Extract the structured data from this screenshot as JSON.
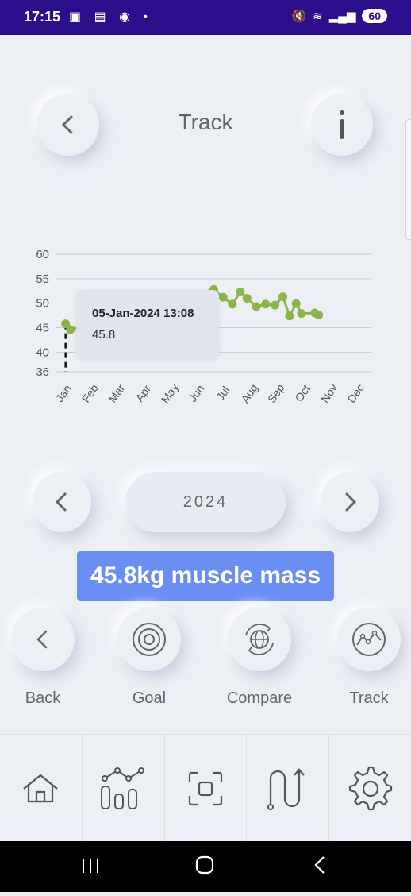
{
  "status_bar": {
    "time": "17:15",
    "battery": "60"
  },
  "header": {
    "title": "Track"
  },
  "chart_data": {
    "type": "line",
    "x_tick_labels": [
      "Jan",
      "Feb",
      "Mar",
      "Apr",
      "May",
      "Jun",
      "Jul",
      "Aug",
      "Sep",
      "Oct",
      "Nov",
      "Dec"
    ],
    "y_tick_labels": [
      "60",
      "55",
      "50",
      "45",
      "40",
      "36"
    ],
    "ylim": [
      36,
      60
    ],
    "grid": true,
    "line_color": "#8bb54a",
    "series": [
      {
        "points": [
          [
            0.02,
            45.8
          ],
          [
            0.2,
            44.6
          ],
          [
            5.6,
            52.8
          ],
          [
            5.95,
            51.2
          ],
          [
            6.3,
            49.8
          ],
          [
            6.6,
            52.3
          ],
          [
            6.85,
            51.0
          ],
          [
            7.2,
            49.3
          ],
          [
            7.55,
            49.8
          ],
          [
            7.9,
            49.6
          ],
          [
            8.2,
            51.3
          ],
          [
            8.45,
            47.4
          ],
          [
            8.7,
            49.9
          ],
          [
            8.9,
            47.9
          ],
          [
            9.4,
            48.0
          ],
          [
            9.55,
            47.6
          ]
        ]
      }
    ],
    "tooltip": {
      "title": "05-Jan-2024 13:08",
      "value": "45.8"
    }
  },
  "year_selector": {
    "year": "2024"
  },
  "measurement_badge": "45.8kg muscle mass",
  "actions": [
    {
      "label": "Back",
      "icon": "chevron-left-icon"
    },
    {
      "label": "Goal",
      "icon": "target-icon"
    },
    {
      "label": "Compare",
      "icon": "globe-sync-icon"
    },
    {
      "label": "Track",
      "icon": "trend-icon"
    }
  ],
  "bottom_nav": [
    "home-icon",
    "chart-icon",
    "scan-icon",
    "route-icon",
    "settings-icon"
  ],
  "colors": {
    "accent": "#6b8ef2",
    "status_bar": "#2b0f8a",
    "background": "#eceff4"
  }
}
